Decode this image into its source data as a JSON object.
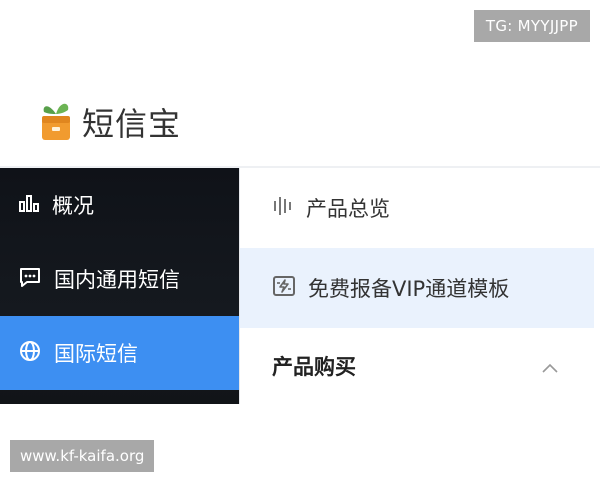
{
  "watermarks": {
    "top": "TG: MYYJJPP",
    "bottom": "www.kf-kaifa.org"
  },
  "brand": {
    "name": "短信宝",
    "logo_icon": "sprout-box-icon"
  },
  "sidebar": {
    "items": [
      {
        "label": "概况",
        "icon": "bar-chart-icon",
        "active": false
      },
      {
        "label": "国内通用短信",
        "icon": "chat-bubble-icon",
        "active": false
      },
      {
        "label": "国际短信",
        "icon": "globe-icon",
        "active": true
      }
    ]
  },
  "panel": {
    "items": [
      {
        "label": "产品总览",
        "icon": "bars-icon",
        "highlight": false
      },
      {
        "label": "免费报备VIP通道模板",
        "icon": "ticket-icon",
        "highlight": true
      }
    ],
    "section": {
      "label": "产品购买",
      "icon": "chevron-up-icon",
      "expanded": true
    }
  },
  "colors": {
    "accent": "#3d8ff2",
    "sidebar_bg": "#111418",
    "highlight_bg": "#eaf2fd"
  }
}
